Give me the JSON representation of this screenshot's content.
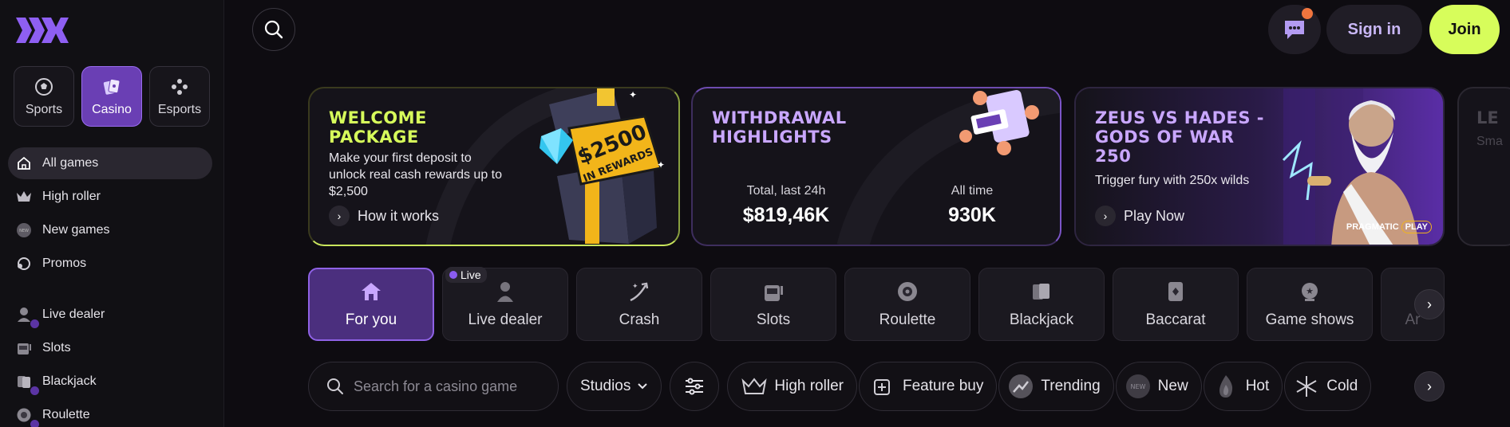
{
  "sidebar": {
    "modes": [
      {
        "label": "Sports",
        "icon": "soccer-ball-icon"
      },
      {
        "label": "Casino",
        "icon": "cards-icon"
      },
      {
        "label": "Esports",
        "icon": "gamepad-icon"
      }
    ],
    "nav": [
      {
        "label": "All games",
        "icon": "home-icon"
      },
      {
        "label": "High roller",
        "icon": "crown-icon"
      },
      {
        "label": "New games",
        "icon": "new-badge-icon"
      },
      {
        "label": "Promos",
        "icon": "promo-icon"
      },
      {
        "label": "Live dealer",
        "icon": "dealer-icon"
      },
      {
        "label": "Slots",
        "icon": "slot-machine-icon"
      },
      {
        "label": "Blackjack",
        "icon": "blackjack-icon"
      },
      {
        "label": "Roulette",
        "icon": "roulette-icon"
      }
    ]
  },
  "header": {
    "signin_label": "Sign in",
    "join_label": "Join"
  },
  "banners": {
    "welcome": {
      "title_line1": "WELCOME",
      "title_line2": "PACKAGE",
      "desc_line1": "Make your first deposit to",
      "desc_line2": "unlock real cash rewards up to",
      "desc_line3": "$2,500",
      "link": "How it works",
      "art_amount": "$2500",
      "art_caption": "IN REWARDS"
    },
    "withdrawal": {
      "title_line1": "WITHDRAWAL",
      "title_line2": "HIGHLIGHTS",
      "stat1_label": "Total, last 24h",
      "stat1_value": "$819,46K",
      "stat2_label": "All time",
      "stat2_value": "930K"
    },
    "zeus": {
      "title_line1": "ZEUS VS HADES -",
      "title_line2": "GODS OF WAR",
      "title_line3": "250",
      "desc": "Trigger fury with 250x wilds",
      "link": "Play Now",
      "provider_a": "PRAGMATIC",
      "provider_b": "PLAY"
    },
    "partial": {
      "title": "LE",
      "desc": "Sma"
    }
  },
  "categories": [
    {
      "label": "For you",
      "icon": "home-icon"
    },
    {
      "label": "Live dealer",
      "icon": "dealer-icon",
      "tag": "Live"
    },
    {
      "label": "Crash",
      "icon": "crash-icon"
    },
    {
      "label": "Slots",
      "icon": "slot-machine-icon"
    },
    {
      "label": "Roulette",
      "icon": "roulette-icon"
    },
    {
      "label": "Blackjack",
      "icon": "blackjack-icon"
    },
    {
      "label": "Baccarat",
      "icon": "baccarat-icon"
    },
    {
      "label": "Game shows",
      "icon": "game-shows-icon"
    },
    {
      "label": "Ar",
      "icon": "arcade-icon"
    }
  ],
  "filters": {
    "search_placeholder": "Search for a casino game",
    "studios_label": "Studios",
    "tags": [
      {
        "label": "High roller",
        "icon": "crown-icon"
      },
      {
        "label": "Feature buy",
        "icon": "feature-buy-icon"
      },
      {
        "label": "Trending",
        "icon": "trending-icon"
      },
      {
        "label": "New",
        "icon": "new-badge-icon"
      },
      {
        "label": "Hot",
        "icon": "flame-icon"
      },
      {
        "label": "Cold",
        "icon": "snowflake-icon"
      }
    ]
  },
  "colors": {
    "accent": "#6a3fb4",
    "join": "#d7fd5b",
    "welcome_title": "#d7fd5b",
    "withdrawal_title": "#c9a7ff",
    "zeus_title": "#c9a7ff"
  }
}
